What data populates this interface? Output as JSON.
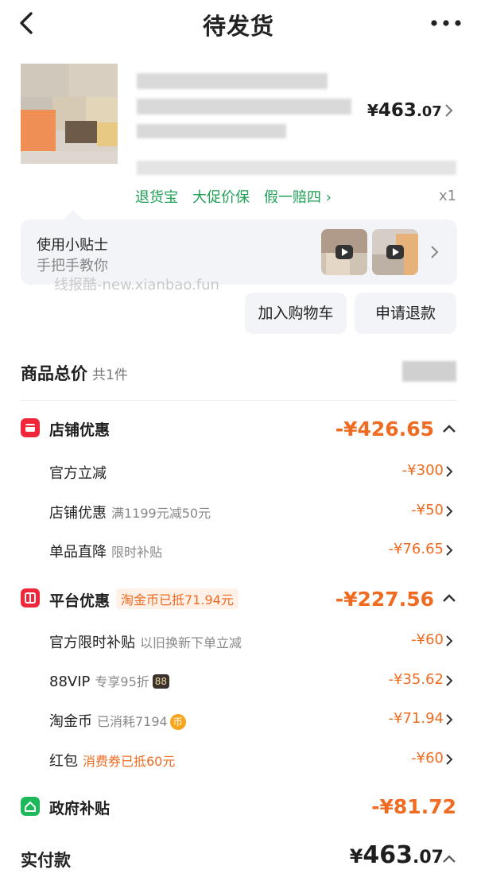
{
  "header": {
    "title": "待发货"
  },
  "product": {
    "price_yen": "¥",
    "price_int": "463",
    "price_dec": ".07",
    "tags": "退货宝　大促价保　假一赔四",
    "qty": "x1"
  },
  "tips": {
    "title": "使用小贴士",
    "subtitle": "手把手教你"
  },
  "watermark": "线报酷-new.xianbao.fun",
  "actions": {
    "add_cart": "加入购物车",
    "refund": "申请退款"
  },
  "totals": {
    "title": "商品总价",
    "count": "共1件"
  },
  "shop": {
    "label": "店铺优惠",
    "amount": "-¥426.65",
    "rows": [
      {
        "label": "官方立减",
        "sub": "",
        "amount": "-¥300"
      },
      {
        "label": "店铺优惠",
        "sub": "满1199元减50元",
        "amount": "-¥50"
      },
      {
        "label": "单品直降",
        "sub": "限时补贴",
        "amount": "-¥76.65"
      }
    ]
  },
  "platform": {
    "label": "平台优惠",
    "badge": "淘金币已抵71.94元",
    "amount": "-¥227.56",
    "rows": [
      {
        "label": "官方限时补贴",
        "sub": "以旧换新下单立减",
        "amount": "-¥60"
      },
      {
        "label": "88VIP",
        "sub": "专享95折",
        "icon_text": "88",
        "amount": "-¥35.62"
      },
      {
        "label": "淘金币",
        "sub": "已消耗7194",
        "icon_text": "币",
        "amount": "-¥71.94"
      },
      {
        "label": "红包",
        "sub": "消费券已抵60元",
        "amount": "-¥60"
      }
    ]
  },
  "gov": {
    "label": "政府补贴",
    "amount": "-¥81.72"
  },
  "pay": {
    "label": "实付款",
    "yen": "¥",
    "int": "463",
    "dec": ".07"
  },
  "colors": {
    "accent_orange": "#f06b22",
    "green": "#1f9f56",
    "red_icon": "#f0263b",
    "gov_green": "#1db85a"
  }
}
